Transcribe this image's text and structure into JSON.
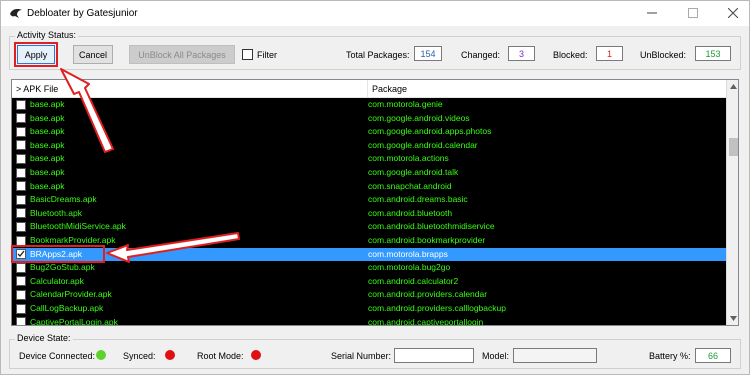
{
  "window": {
    "title": "Debloater by Gatesjunior"
  },
  "activity": {
    "group_label": "Activity Status:",
    "apply_label": "Apply",
    "cancel_label": "Cancel",
    "unblock_all_label": "UnBlock All Packages",
    "filter_label": "Filter",
    "total_label": "Total Packages:",
    "total_value": "154",
    "changed_label": "Changed:",
    "changed_value": "3",
    "blocked_label": "Blocked:",
    "blocked_value": "1",
    "unblocked_label": "UnBlocked:",
    "unblocked_value": "153",
    "colors": {
      "total": "#2a62b4",
      "changed": "#7b2fc9",
      "blocked": "#e01f1f",
      "unblocked": "#1f9a3a"
    }
  },
  "grid": {
    "col_apk": "> APK File",
    "col_package": "Package",
    "text_color": "#39ff14",
    "selected_color": "#3399ff",
    "rows": [
      {
        "apk": "base.apk",
        "package": "com.motorola.genie",
        "checked": false
      },
      {
        "apk": "base.apk",
        "package": "com.google.android.videos",
        "checked": false
      },
      {
        "apk": "base.apk",
        "package": "com.google.android.apps.photos",
        "checked": false
      },
      {
        "apk": "base.apk",
        "package": "com.google.android.calendar",
        "checked": false
      },
      {
        "apk": "base.apk",
        "package": "com.motorola.actions",
        "checked": false
      },
      {
        "apk": "base.apk",
        "package": "com.google.android.talk",
        "checked": false
      },
      {
        "apk": "base.apk",
        "package": "com.snapchat.android",
        "checked": false
      },
      {
        "apk": "BasicDreams.apk",
        "package": "com.android.dreams.basic",
        "checked": false
      },
      {
        "apk": "Bluetooth.apk",
        "package": "com.android.bluetooth",
        "checked": false
      },
      {
        "apk": "BluetoothMidiService.apk",
        "package": "com.android.bluetoothmidiservice",
        "checked": false
      },
      {
        "apk": "BookmarkProvider.apk",
        "package": "com.android.bookmarkprovider",
        "checked": false
      },
      {
        "apk": "BRApps2.apk",
        "package": "com.motorola.brapps",
        "checked": true,
        "selected": true
      },
      {
        "apk": "Bug2GoStub.apk",
        "package": "com.motorola.bug2go",
        "checked": false
      },
      {
        "apk": "Calculator.apk",
        "package": "com.android.calculator2",
        "checked": false
      },
      {
        "apk": "CalendarProvider.apk",
        "package": "com.android.providers.calendar",
        "checked": false
      },
      {
        "apk": "CallLogBackup.apk",
        "package": "com.android.providers.calllogbackup",
        "checked": false
      },
      {
        "apk": "CaptivePortalLogin.apk",
        "package": "com.android.captiveportallogin",
        "checked": false
      }
    ]
  },
  "device": {
    "group_label": "Device State:",
    "connected_label": "Device Connected:",
    "connected_color": "#5fd12e",
    "synced_label": "Synced:",
    "synced_color": "#e01010",
    "root_label": "Root Mode:",
    "root_color": "#e01010",
    "serial_label": "Serial Number:",
    "serial_value": "",
    "model_label": "Model:",
    "model_value": "",
    "battery_label": "Battery %:",
    "battery_value": "66",
    "battery_color": "#1f9a3a"
  },
  "annotation": {
    "color": "#e02020"
  }
}
